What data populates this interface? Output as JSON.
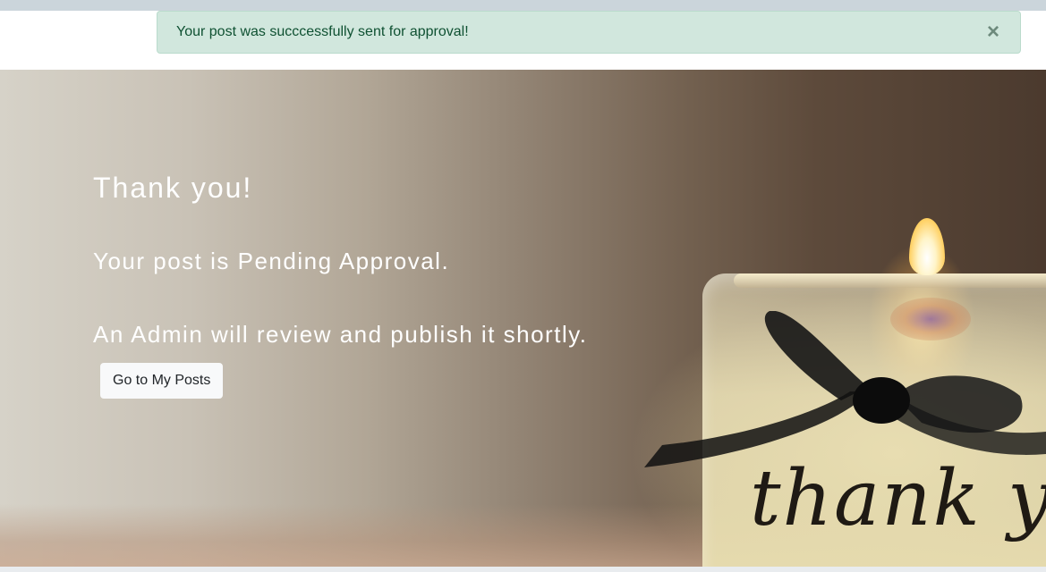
{
  "alert": {
    "message": "Your post was succcessfully sent for approval!",
    "close_symbol": "×",
    "background": "#d1e7dd",
    "text_color": "#0f5132"
  },
  "hero": {
    "title": "Thank you!",
    "line1": "Your post is Pending Approval.",
    "line2": "An Admin will review and publish it shortly.",
    "button_label": "Go to My Posts",
    "image_text": "thank you"
  }
}
